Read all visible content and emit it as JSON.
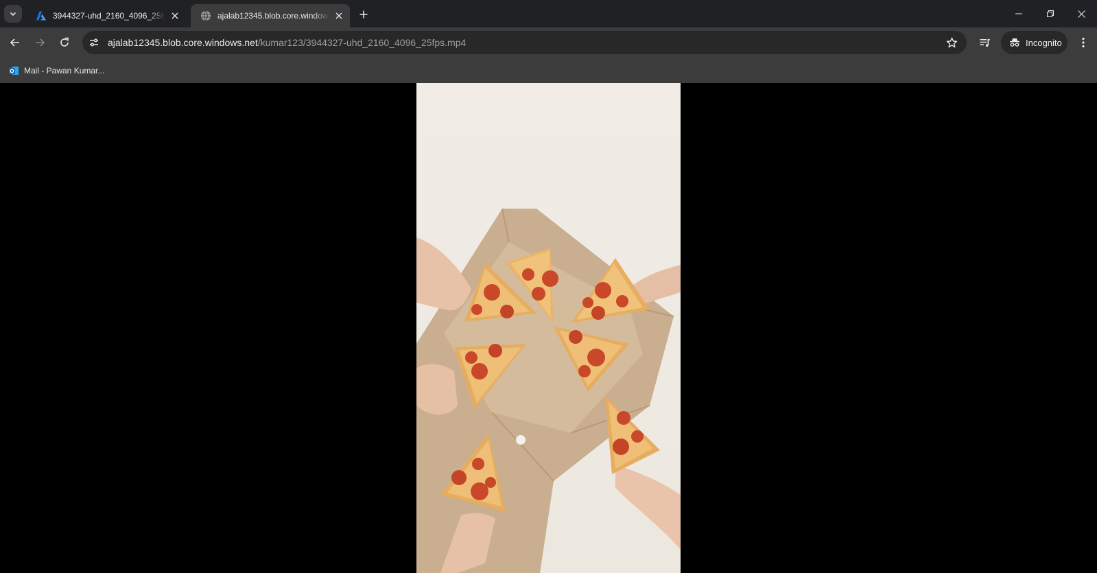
{
  "tabs": [
    {
      "title": "3944327-uhd_2160_4096_25fps.mp4",
      "favicon": "azure-icon",
      "active": false
    },
    {
      "title": "ajalab12345.blob.core.windows.net",
      "favicon": "globe-icon",
      "active": true
    }
  ],
  "address_bar": {
    "host": "ajalab12345.blob.core.windows.net",
    "path": "/kumar123/3944327-uhd_2160_4096_25fps.mp4"
  },
  "profile": {
    "label": "Incognito"
  },
  "bookmarks": [
    {
      "label": "Mail - Pawan Kumar...",
      "icon": "outlook-icon"
    }
  ],
  "colors": {
    "accent_blue": "#0f6cbd",
    "chrome_dark": "#202124",
    "toolbar": "#3c3c3c"
  }
}
